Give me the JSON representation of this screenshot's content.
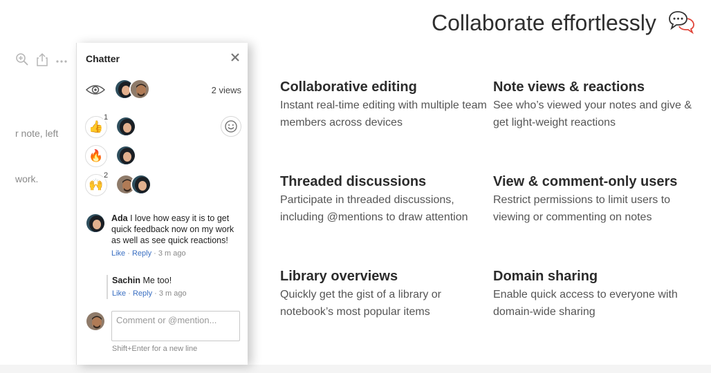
{
  "headline": "Collaborate effortlessly",
  "background_note": {
    "text_lines": [
      "r note, left",
      "work."
    ]
  },
  "chatter": {
    "title": "Chatter",
    "views_label": "2 views",
    "reactions": [
      {
        "emoji": "👍",
        "count": "1",
        "icon": "thumbs-up-icon"
      },
      {
        "emoji": "🔥",
        "count": "",
        "icon": "fire-icon"
      },
      {
        "emoji": "🙌",
        "count": "2",
        "icon": "raised-hands-icon"
      }
    ],
    "comments": [
      {
        "author": "Ada",
        "text": "I love how easy it is to get quick feedback now on my work as well as see quick reactions!",
        "like": "Like",
        "reply": "Reply",
        "time": "3 m ago"
      }
    ],
    "replies": [
      {
        "author": "Sachin",
        "text": "Me too!",
        "like": "Like",
        "reply": "Reply",
        "time": "3 m ago"
      }
    ],
    "composer": {
      "placeholder": "Comment or @mention...",
      "hint": "Shift+Enter for a new line"
    }
  },
  "features": [
    {
      "title": "Collaborative editing",
      "description": "Instant real-time editing with multiple team members across devices"
    },
    {
      "title": "Note views & reactions",
      "description": "See who’s viewed your notes and give & get light-weight reactions"
    },
    {
      "title": "Threaded discussions",
      "description": "Participate in threaded discussions, including @mentions to draw attention"
    },
    {
      "title": "View & comment-only users",
      "description": "Restrict permissions to limit users to viewing or commenting on notes"
    },
    {
      "title": "Library overviews",
      "description": "Quickly get the gist of a library or notebook’s most popular items"
    },
    {
      "title": "Domain sharing",
      "description": "Enable quick access to everyone with domain-wide sharing"
    }
  ],
  "colors": {
    "link": "#3a6fc2",
    "headline_icon_accent": "#e0453a"
  }
}
